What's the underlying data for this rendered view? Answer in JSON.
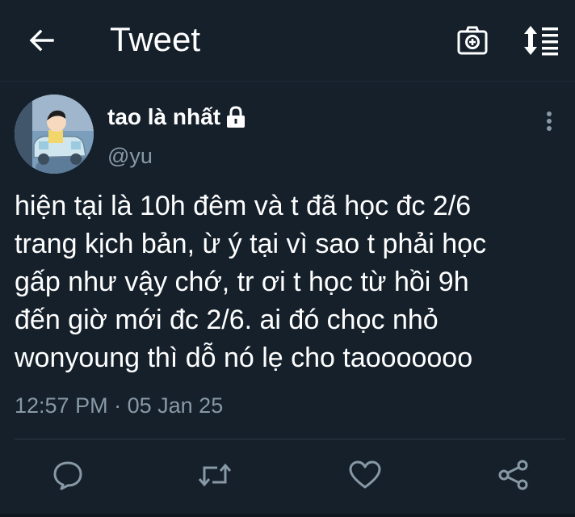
{
  "header": {
    "title": "Tweet",
    "back_icon": "arrow-left-icon",
    "camera_icon": "camera-icon",
    "sort_icon": "sort-icon"
  },
  "tweet": {
    "display_name": "tao là nhất",
    "handle": "@yu",
    "protected": true,
    "text": "hiện tại là 10h đêm và t đã học đc 2/6\ntrang kịch bản, ừ ý tại vì sao t phải học\ngấp như vậy chớ, tr ơi t học từ hồi 9h\nđến giờ mới đc 2/6. ai đó chọc nhỏ\nwonyoung thì dỗ nó lẹ cho taooooooo",
    "time": "12:57 PM",
    "separator": "·",
    "date": "05 Jan 25"
  },
  "actions": {
    "reply_icon": "reply-icon",
    "retweet_icon": "retweet-icon",
    "like_icon": "heart-icon",
    "share_icon": "share-icon"
  },
  "colors": {
    "background": "#15202b",
    "text_primary": "#ffffff",
    "text_secondary": "#8899a6",
    "divider": "#2b3845"
  }
}
